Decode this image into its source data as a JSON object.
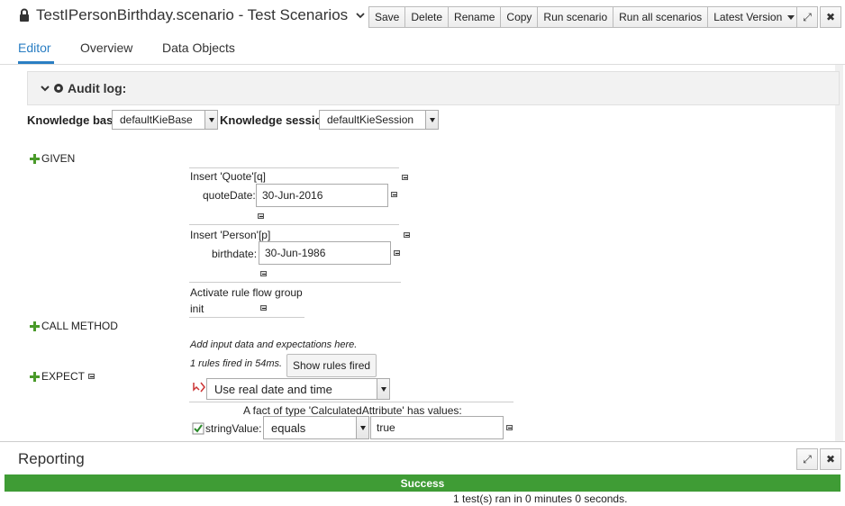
{
  "header": {
    "title": "TestIPersonBirthday.scenario - Test Scenarios",
    "buttons": [
      "Save",
      "Delete",
      "Rename",
      "Copy",
      "Run scenario",
      "Run all scenarios",
      "Latest Version"
    ]
  },
  "tabs": [
    {
      "label": "Editor",
      "active": true
    },
    {
      "label": "Overview",
      "active": false
    },
    {
      "label": "Data Objects",
      "active": false
    }
  ],
  "audit": {
    "label": "Audit log:"
  },
  "knowledge": {
    "base_label": "Knowledge base",
    "base_value": "defaultKieBase",
    "session_label": "Knowledge session",
    "session_value": "defaultKieSession"
  },
  "given": {
    "label": "GIVEN",
    "quote_header": "Insert 'Quote'[q]",
    "quote_field": "quoteDate:",
    "quote_value": "30-Jun-2016",
    "person_header": "Insert 'Person'[p]",
    "person_field": "birthdate:",
    "person_value": "30-Jun-1986",
    "activate_label": "Activate rule flow group",
    "activate_value": "init"
  },
  "call_method": {
    "label": "CALL METHOD"
  },
  "hints": {
    "add_data": "Add input data and expectations here.",
    "rules_fired": "1 rules fired in 54ms.",
    "show_rules": "Show rules fired"
  },
  "expect": {
    "label": "EXPECT",
    "date_option": "Use real date and time",
    "fact_header": "A fact of type 'CalculatedAttribute' has values:",
    "field": "stringValue:",
    "operator": "equals",
    "value": "true"
  },
  "reporting": {
    "title": "Reporting",
    "status": "Success",
    "summary": "1 test(s) ran in 0 minutes 0 seconds."
  },
  "colors": {
    "accent": "#2a7ec3",
    "success": "#3f9c35"
  }
}
